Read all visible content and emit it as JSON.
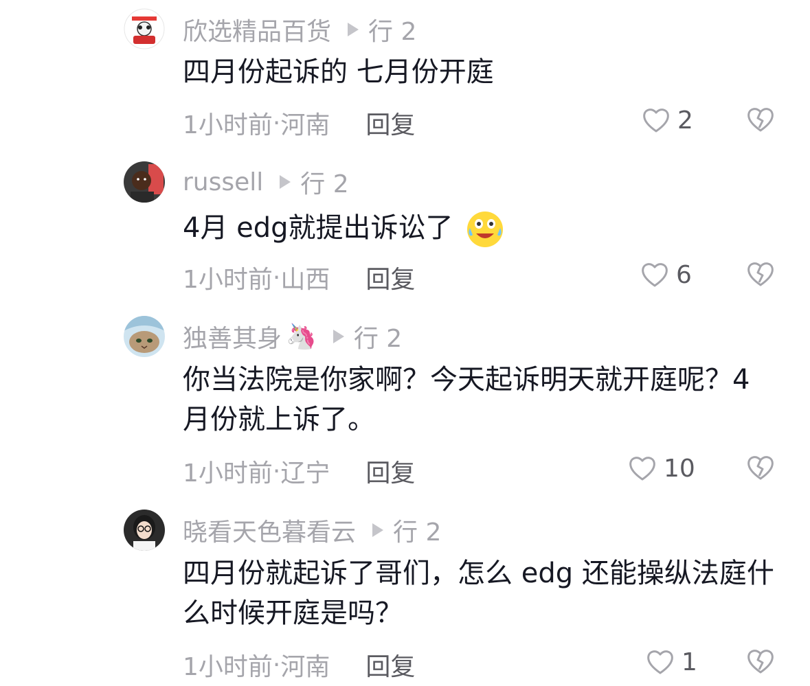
{
  "comments": [
    {
      "username": "欣选精品百货",
      "username_emoji": "",
      "reply_target": "行 2",
      "text": "四月份起诉的 七月份开庭",
      "text_emoji": "",
      "time": "1小时前",
      "location": "河南",
      "reply_label": "回复",
      "likes": "2"
    },
    {
      "username": "russell",
      "username_emoji": "",
      "reply_target": "行 2",
      "text": "4月 edg就提出诉讼了",
      "text_emoji": "laughing-crying-emoji",
      "time": "1小时前",
      "location": "山西",
      "reply_label": "回复",
      "likes": "6"
    },
    {
      "username": "独善其身",
      "username_emoji": "🦄",
      "reply_target": "行 2",
      "text": "你当法院是你家啊？今天起诉明天就开庭呢？4月份就上诉了。",
      "text_emoji": "",
      "time": "1小时前",
      "location": "辽宁",
      "reply_label": "回复",
      "likes": "10"
    },
    {
      "username": "晓看天色暮看云",
      "username_emoji": "",
      "reply_target": "行 2",
      "text": "四月份就起诉了哥们，怎么 edg 还能操纵法庭什么时候开庭是吗？",
      "text_emoji": "",
      "time": "1小时前",
      "location": "河南",
      "reply_label": "回复",
      "likes": "1"
    }
  ],
  "separator": " · ",
  "colors": {
    "text_primary": "#161823",
    "text_secondary": "#a5a5ab",
    "reply_button": "#5a5a60",
    "icon_stroke": "#a5a5ab"
  }
}
